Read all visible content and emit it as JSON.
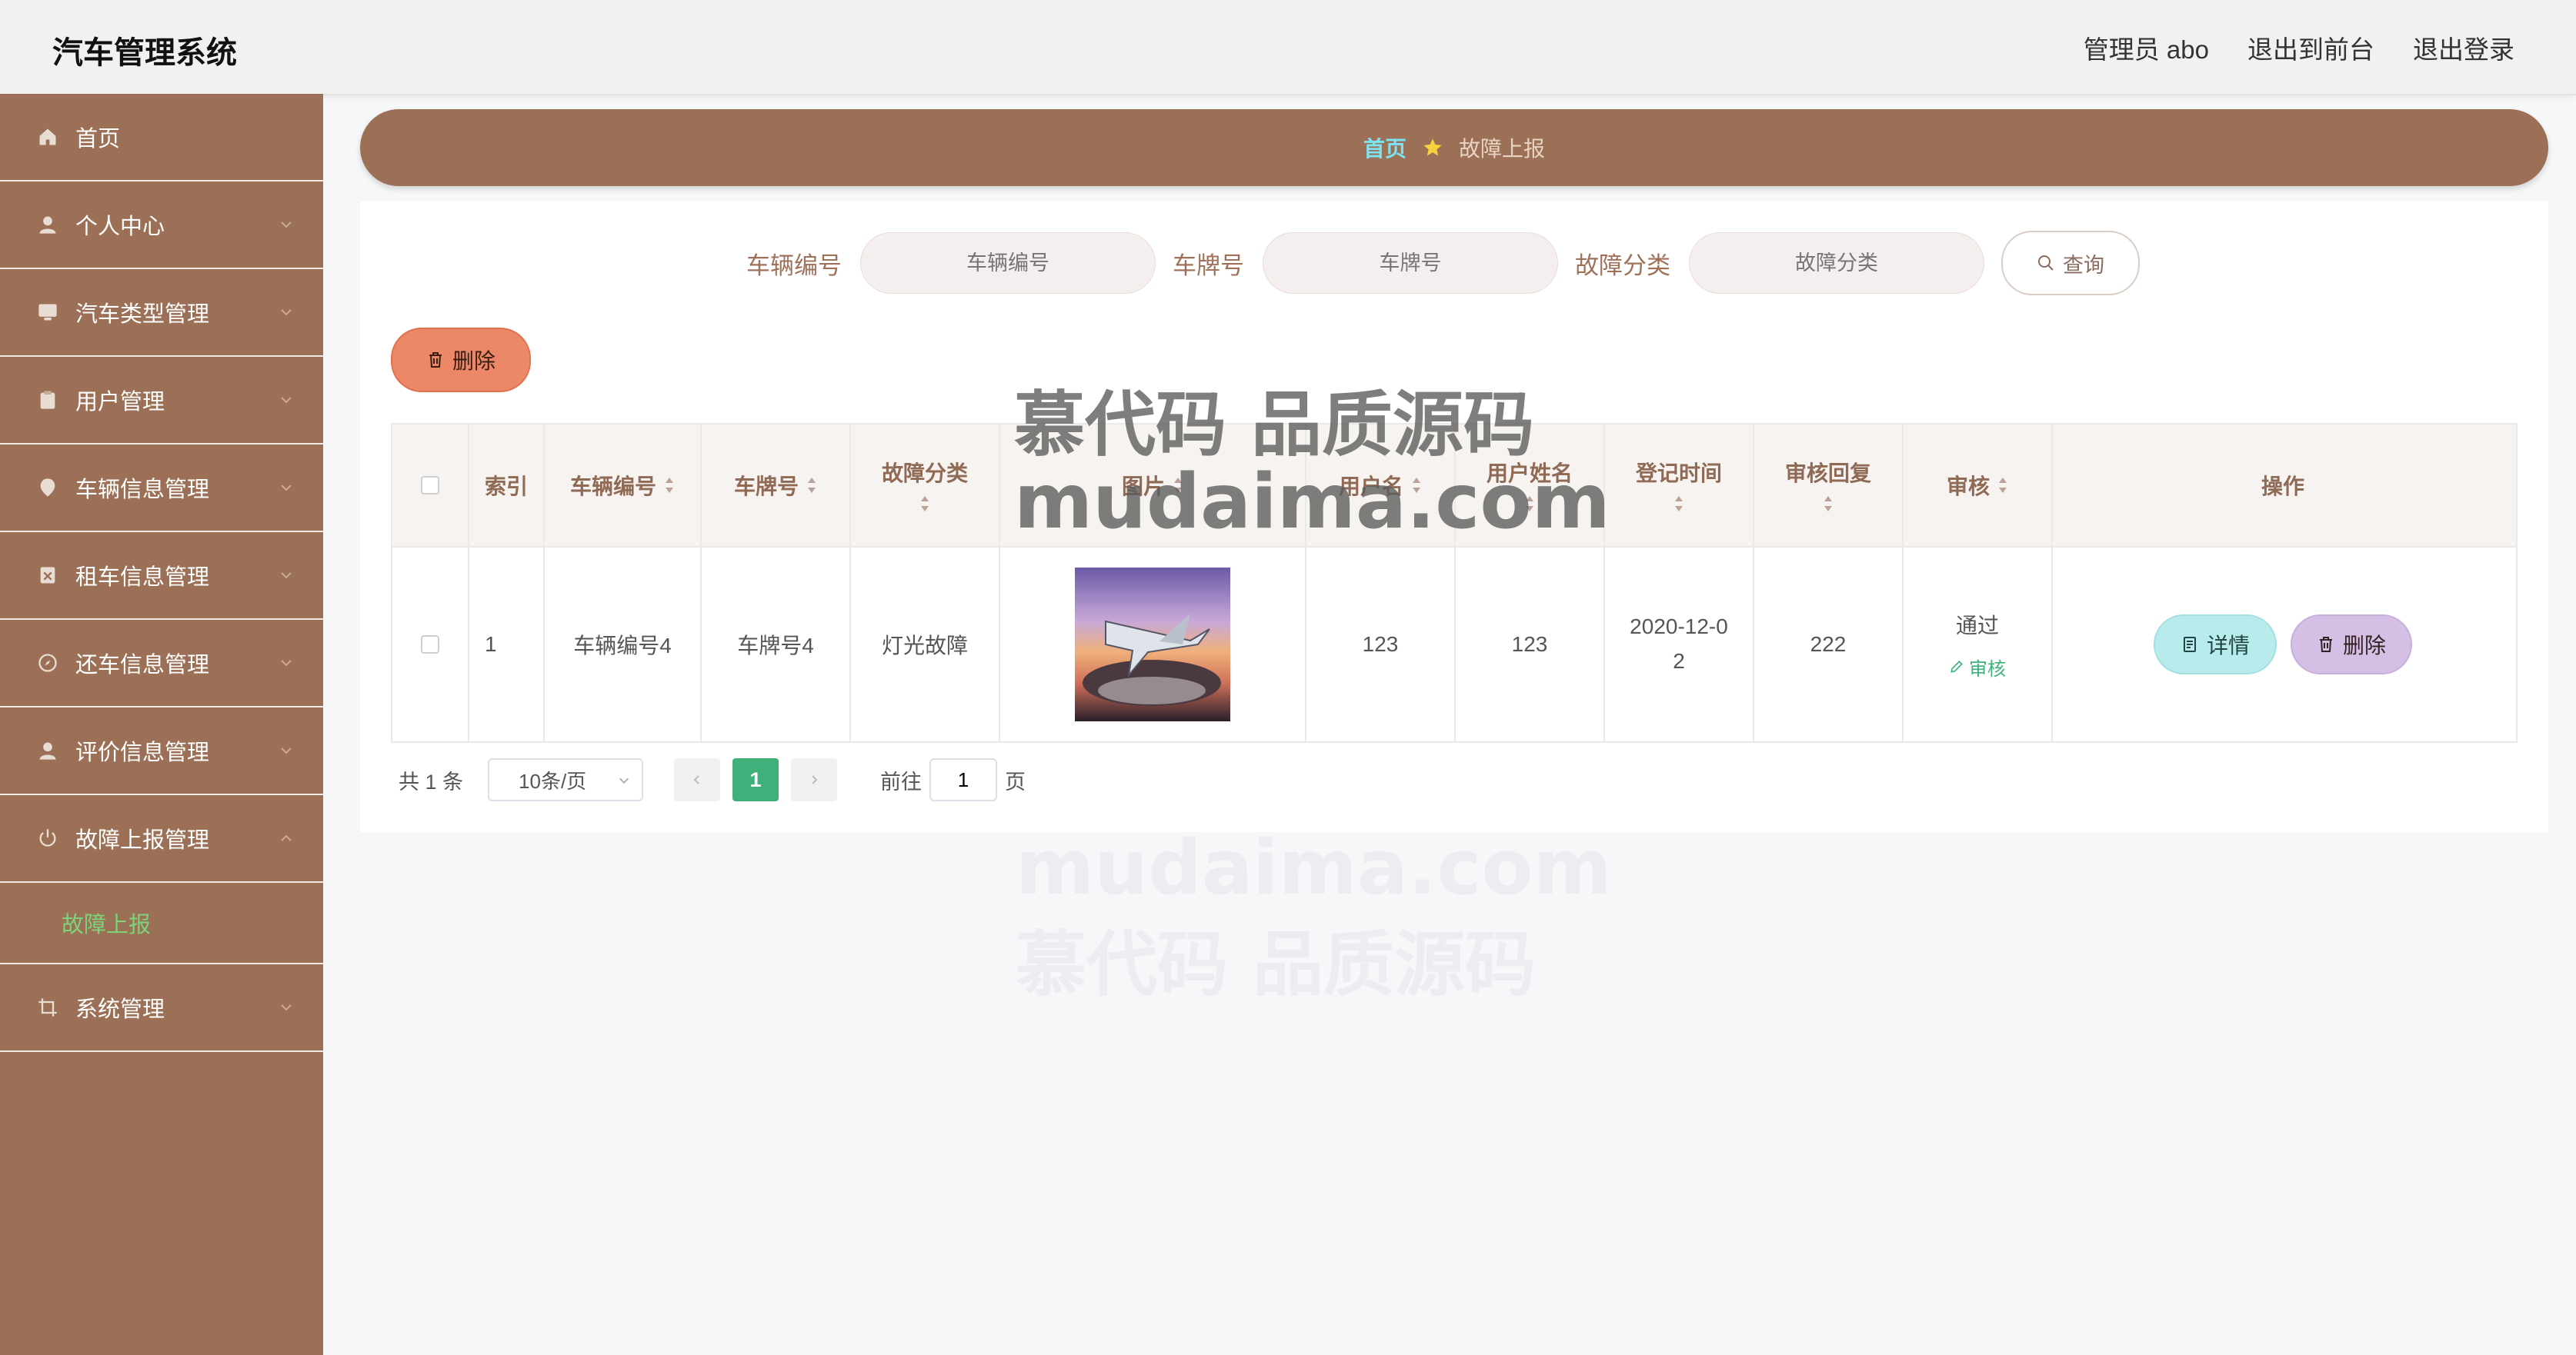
{
  "app": {
    "title": "汽车管理系统"
  },
  "topbar": {
    "admin": "管理员 abo",
    "to_front": "退出到前台",
    "logout": "退出登录"
  },
  "sidebar": {
    "items": [
      {
        "label": "首页"
      },
      {
        "label": "个人中心"
      },
      {
        "label": "汽车类型管理"
      },
      {
        "label": "用户管理"
      },
      {
        "label": "车辆信息管理"
      },
      {
        "label": "租车信息管理"
      },
      {
        "label": "还车信息管理"
      },
      {
        "label": "评价信息管理"
      },
      {
        "label": "故障上报管理"
      },
      {
        "label": "系统管理"
      }
    ],
    "sub_active": "故障上报"
  },
  "breadcrumb": {
    "home": "首页",
    "current": "故障上报",
    "separator_icon": "star-icon"
  },
  "search": {
    "vehicle_no_label": "车辆编号",
    "vehicle_no_placeholder": "车辆编号",
    "plate_label": "车牌号",
    "plate_placeholder": "车牌号",
    "category_label": "故障分类",
    "category_placeholder": "故障分类",
    "query_label": "查询"
  },
  "toolbar": {
    "delete_label": "删除"
  },
  "table": {
    "headers": [
      "索引",
      "车辆编号",
      "车牌号",
      "故障分类",
      "图片",
      "用户名",
      "用户姓名",
      "登记时间",
      "审核回复",
      "审核",
      "操作"
    ],
    "rows": [
      {
        "index": "1",
        "vehicle_no": "车辆编号4",
        "plate": "车牌号4",
        "category": "灯光故障",
        "username": "123",
        "realname": "123",
        "reg_time": "2020-12-0\n2",
        "reply": "222",
        "status": "通过",
        "audit_link": "审核",
        "detail": "详情",
        "delete": "删除"
      }
    ]
  },
  "pagination": {
    "total": "共 1 条",
    "page_size": "10条/页",
    "current": "1",
    "goto_label": "前往",
    "goto_value": "1",
    "page_suffix": "页"
  },
  "watermark": {
    "line1": "慕代码 品质源码",
    "line2": "mudaima.com"
  },
  "colors": {
    "brand": "#9b7056",
    "accent_green": "#3fb07a",
    "crumb_home": "#7ee3f0"
  }
}
